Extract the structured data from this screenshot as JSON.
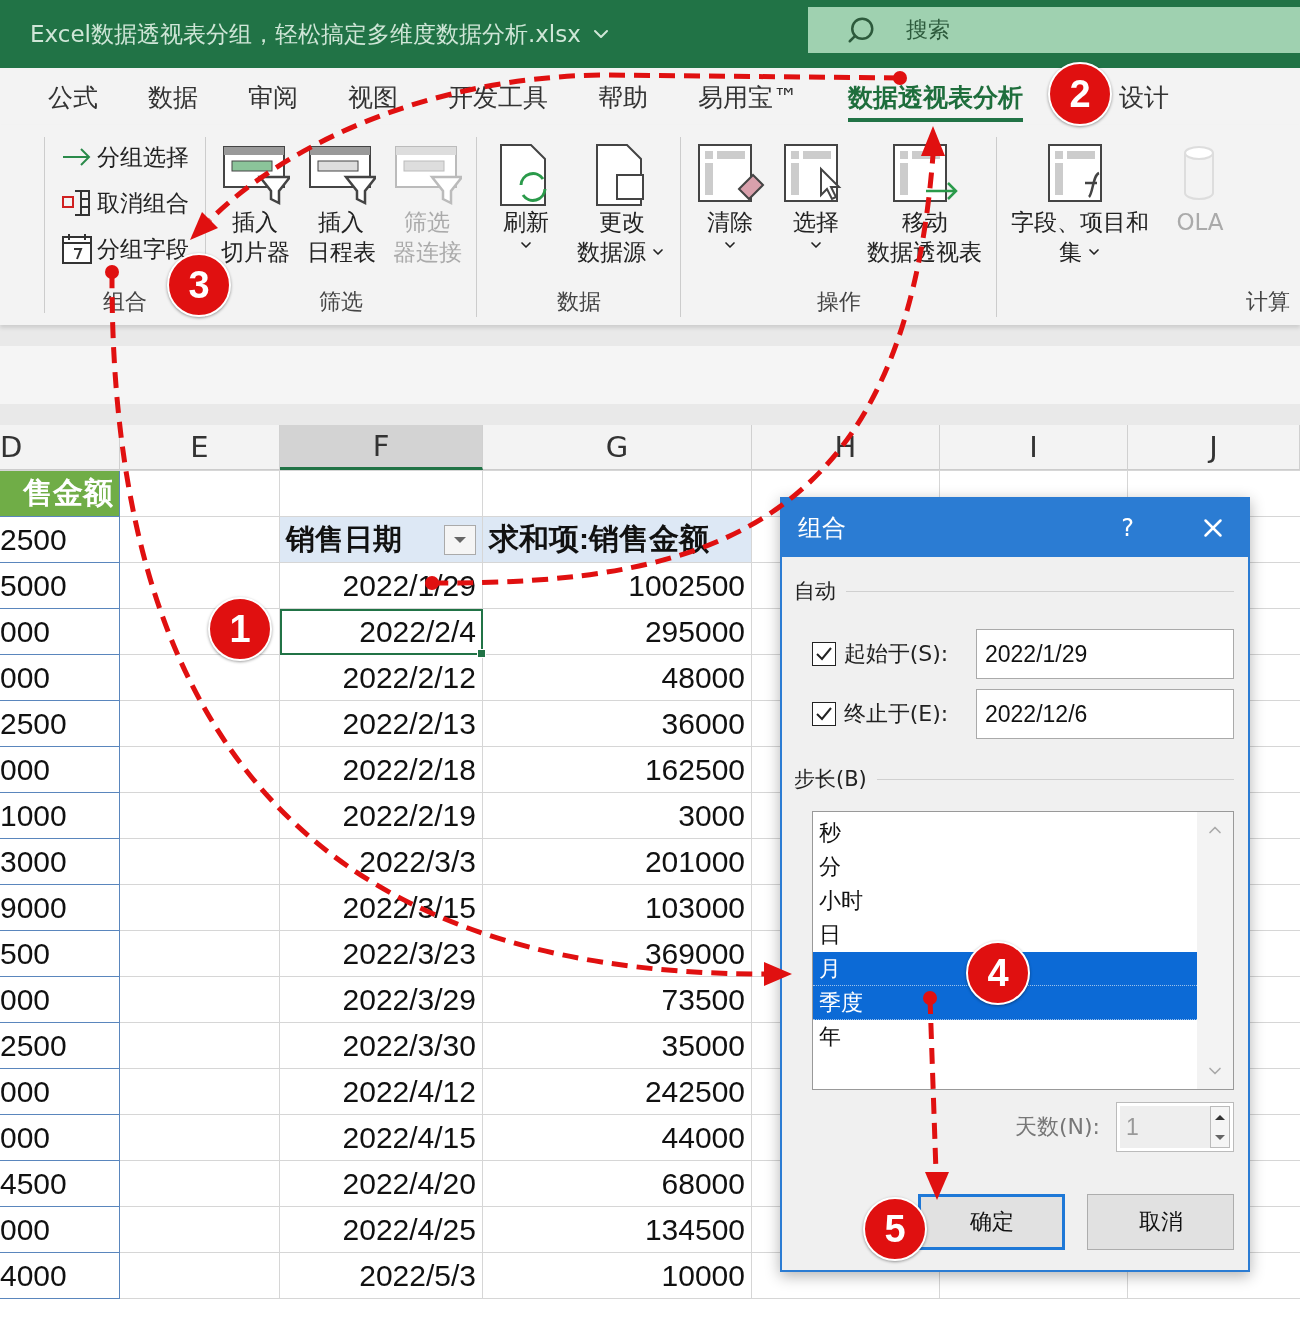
{
  "title_bar": {
    "title": "Excel数据透视表分组，轻松搞定多维度数据分析.xlsx",
    "search": {
      "placeholder": "搜索"
    }
  },
  "tabs": [
    {
      "label": "公式",
      "selected": false
    },
    {
      "label": "数据",
      "selected": false
    },
    {
      "label": "审阅",
      "selected": false
    },
    {
      "label": "视图",
      "selected": false
    },
    {
      "label": "开发工具",
      "selected": false
    },
    {
      "label": "帮助",
      "selected": false
    },
    {
      "label": "易用宝™",
      "selected": false
    },
    {
      "label": "数据透视表分析",
      "selected": true
    },
    {
      "label": "设计",
      "selected": false
    }
  ],
  "ribbon": {
    "groups": [
      {
        "label": "组合",
        "buttons": [
          {
            "kind": "small",
            "label_lines": [
              "分组选择"
            ],
            "dropdown": false,
            "disabled": false
          },
          {
            "kind": "small",
            "label_lines": [
              "取消组合"
            ],
            "dropdown": false,
            "disabled": false
          },
          {
            "kind": "small",
            "label_lines": [
              "分组字段"
            ],
            "dropdown": false,
            "disabled": false
          }
        ]
      },
      {
        "label": "筛选",
        "buttons": [
          {
            "kind": "large",
            "label_lines": [
              "插入",
              "切片器"
            ],
            "dropdown": false,
            "disabled": false
          },
          {
            "kind": "large",
            "label_lines": [
              "插入",
              "日程表"
            ],
            "dropdown": false,
            "disabled": false
          },
          {
            "kind": "large",
            "label_lines": [
              "筛选",
              "器连接"
            ],
            "dropdown": false,
            "disabled": true
          }
        ]
      },
      {
        "label": "数据",
        "buttons": [
          {
            "kind": "large",
            "label_lines": [
              "刷新"
            ],
            "dropdown": true,
            "disabled": false
          },
          {
            "kind": "large",
            "label_lines": [
              "更改",
              "数据源"
            ],
            "dropdown": true,
            "disabled": false
          }
        ]
      },
      {
        "label": "操作",
        "buttons": [
          {
            "kind": "large",
            "label_lines": [
              "清除"
            ],
            "dropdown": true,
            "disabled": false
          },
          {
            "kind": "large",
            "label_lines": [
              "选择"
            ],
            "dropdown": true,
            "disabled": false
          },
          {
            "kind": "large",
            "label_lines": [
              "移动",
              "数据透视表"
            ],
            "dropdown": false,
            "disabled": false
          }
        ]
      },
      {
        "label": "计算",
        "buttons": [
          {
            "kind": "large",
            "label_lines": [
              "字段、项目和",
              "集"
            ],
            "dropdown": true,
            "disabled": false
          },
          {
            "kind": "large",
            "label_lines": [
              "OLA"
            ],
            "dropdown": false,
            "disabled": true
          }
        ]
      }
    ]
  },
  "sheet": {
    "columns": [
      {
        "label": "D",
        "selected": false
      },
      {
        "label": "E",
        "selected": false
      },
      {
        "label": "F",
        "selected": true
      },
      {
        "label": "G",
        "selected": false
      },
      {
        "label": "H",
        "selected": false
      },
      {
        "label": "I",
        "selected": false
      },
      {
        "label": "J",
        "selected": false
      }
    ],
    "d_header": "售金额",
    "d_values": [
      "2500",
      "5000",
      "000",
      "000",
      "2500",
      "000",
      "1000",
      "3000",
      "9000",
      "500",
      "000",
      "2500",
      "000",
      "000",
      "4500",
      "000",
      "4000"
    ],
    "pivot": {
      "headers": [
        "销售日期",
        "求和项:销售金额"
      ],
      "rows": [
        {
          "date": "2022/1/29",
          "amount": "1002500",
          "selected": false
        },
        {
          "date": "2022/2/4",
          "amount": "295000",
          "selected": true
        },
        {
          "date": "2022/2/12",
          "amount": "48000",
          "selected": false
        },
        {
          "date": "2022/2/13",
          "amount": "36000",
          "selected": false
        },
        {
          "date": "2022/2/18",
          "amount": "162500",
          "selected": false
        },
        {
          "date": "2022/2/19",
          "amount": "3000",
          "selected": false
        },
        {
          "date": "2022/3/3",
          "amount": "201000",
          "selected": false
        },
        {
          "date": "2022/3/15",
          "amount": "103000",
          "selected": false
        },
        {
          "date": "2022/3/23",
          "amount": "369000",
          "selected": false
        },
        {
          "date": "2022/3/29",
          "amount": "73500",
          "selected": false
        },
        {
          "date": "2022/3/30",
          "amount": "35000",
          "selected": false
        },
        {
          "date": "2022/4/12",
          "amount": "242500",
          "selected": false
        },
        {
          "date": "2022/4/15",
          "amount": "44000",
          "selected": false
        },
        {
          "date": "2022/4/20",
          "amount": "68000",
          "selected": false
        },
        {
          "date": "2022/4/25",
          "amount": "134500",
          "selected": false
        },
        {
          "date": "2022/5/3",
          "amount": "10000",
          "selected": false
        }
      ]
    }
  },
  "dialog": {
    "title": "组合",
    "help": "?",
    "auto_label": "自动",
    "bounds": [
      {
        "label": "起始于(S):",
        "checked": true,
        "value": "2022/1/29"
      },
      {
        "label": "终止于(E):",
        "checked": true,
        "value": "2022/12/6"
      }
    ],
    "step_label": "步长(B)",
    "steps": [
      {
        "label": "秒",
        "selected": false
      },
      {
        "label": "分",
        "selected": false
      },
      {
        "label": "小时",
        "selected": false
      },
      {
        "label": "日",
        "selected": false
      },
      {
        "label": "月",
        "selected": true
      },
      {
        "label": "季度",
        "selected": true
      },
      {
        "label": "年",
        "selected": false
      }
    ],
    "days": {
      "label": "天数(N):",
      "value": "1",
      "disabled": true
    },
    "buttons": [
      {
        "label": "确定",
        "default": true
      },
      {
        "label": "取消",
        "default": false
      }
    ]
  },
  "annotations": [
    {
      "label": "1"
    },
    {
      "label": "2"
    },
    {
      "label": "3"
    },
    {
      "label": "4"
    },
    {
      "label": "5"
    }
  ]
}
